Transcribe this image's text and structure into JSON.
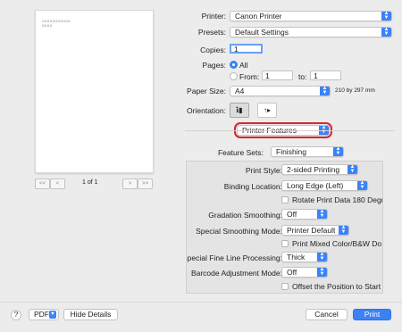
{
  "preview": {
    "line1": "ooooooooooo",
    "line2": "oooo",
    "page_indicator": "1 of 1",
    "first_label": "<<",
    "prev_label": "<",
    "next_label": ">",
    "last_label": ">>"
  },
  "printer": {
    "label": "Printer:",
    "value": "Canon Printer"
  },
  "presets": {
    "label": "Presets:",
    "value": "Default Settings"
  },
  "copies": {
    "label": "Copies:",
    "value": "1"
  },
  "pages": {
    "label": "Pages:",
    "all_label": "All",
    "from_label": "From:",
    "from_value": "1",
    "to_label": "to:",
    "to_value": "1",
    "selected": "All"
  },
  "paper_size": {
    "label": "Paper Size:",
    "value": "A4",
    "dimensions": "210 by 297 mm"
  },
  "orientation": {
    "label": "Orientation:",
    "portrait_icon": "person-portrait-icon",
    "landscape_icon": "person-landscape-icon",
    "selected": "portrait"
  },
  "section": {
    "value": "Printer Features",
    "highlight_color": "#d9262b"
  },
  "feature_sets": {
    "label": "Feature Sets:",
    "value": "Finishing"
  },
  "features": {
    "print_style": {
      "label": "Print Style:",
      "value": "2-sided Printing"
    },
    "binding_location": {
      "label": "Binding Location:",
      "value": "Long Edge (Left)"
    },
    "rotate": {
      "label": "Rotate Print Data 180 Degr",
      "checked": false
    },
    "gradation": {
      "label": "Gradation Smoothing:",
      "value": "Off"
    },
    "special_smoothing": {
      "label": "Special Smoothing Mode:",
      "value": "Printer Default"
    },
    "mixed_color": {
      "label": "Print Mixed Color/B&W Do",
      "checked": false
    },
    "fine_line": {
      "label": "Special Fine Line Processing:",
      "value": "Thick"
    },
    "barcode": {
      "label": "Barcode Adjustment Mode:",
      "value": "Off"
    },
    "offset": {
      "label": "Offset the Position to Start",
      "checked": false
    }
  },
  "bottom": {
    "help": "?",
    "pdf": "PDF",
    "hide_details": "Hide Details",
    "cancel": "Cancel",
    "print": "Print"
  },
  "colors": {
    "accent": "#3b82f6",
    "background": "#ececec"
  }
}
